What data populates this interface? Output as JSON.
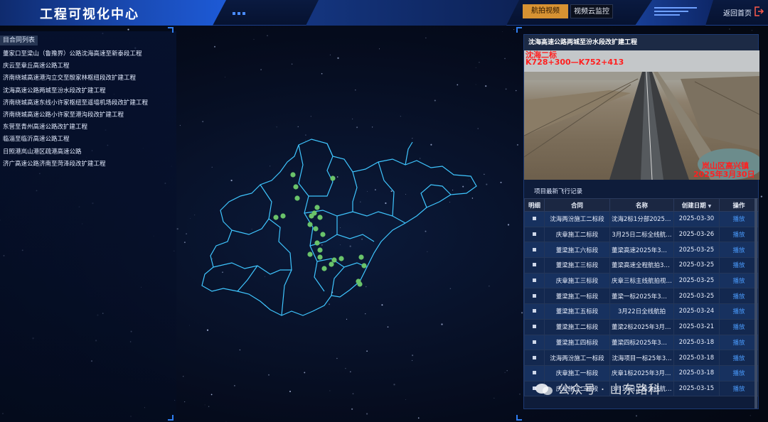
{
  "header": {
    "title": "工程可视化中心",
    "tabs": [
      {
        "label": "航拍视频",
        "active": true
      },
      {
        "label": "视频云监控",
        "active": false
      }
    ],
    "back_label": "返回首页",
    "accent_color": "#1d5ad6",
    "active_tab_color": "#d79232"
  },
  "left_panel": {
    "header": "目合同列表",
    "projects": [
      "董家口至梁山（鲁豫界）公路沈海高速至新泰段工程",
      "庆云至章丘高速公路工程",
      "济南绕城高速港沟立交至殷家林枢纽段改扩建工程",
      "沈海高速公路两城至汾水段改扩建工程",
      "济南绕城高速东线小许家枢纽至遥墙机场段改扩建工程",
      "济南绕城高速公路小许家至港沟段改扩建工程",
      "东营至青州高速公路改扩建工程",
      "临淄至临沂高速公路工程",
      "日照港岚山港区疏港高速公路",
      "济广高速公路济南至菏泽段改扩建工程"
    ]
  },
  "map": {
    "region_outline_color": "#3fc6ff",
    "marker_color": "#6ac36a"
  },
  "right_panel": {
    "title": "沈海高速公路两城至汾水段改扩建工程",
    "video": {
      "overlay_line1": "沈海二标",
      "overlay_line2": "K728+300—K752+413",
      "overlay_location": "岚山区高兴镇",
      "overlay_date": "2025年3月30日"
    },
    "section_label": "项目最新飞行记录",
    "table": {
      "columns": [
        "明细",
        "合同",
        "名称",
        "创建日期",
        "操作"
      ],
      "rows": [
        {
          "contract": "沈海两汾施工二标段",
          "name": "沈海2标1分部2025年…",
          "date": "2025-03-30",
          "action": "播放"
        },
        {
          "contract": "庆章施工二标段",
          "name": "3月25日二标全线航…",
          "date": "2025-03-26",
          "action": "播放"
        },
        {
          "contract": "董梁施工六标段",
          "name": "董梁高速2025年3月2…",
          "date": "2025-03-25",
          "action": "播放"
        },
        {
          "contract": "董梁施工三标段",
          "name": "董梁高速全程航拍3月…",
          "date": "2025-03-25",
          "action": "播放"
        },
        {
          "contract": "庆章施工三标段",
          "name": "庆章三标主线航拍视…",
          "date": "2025-03-25",
          "action": "播放"
        },
        {
          "contract": "董梁施工一标段",
          "name": "董梁一标2025年3月…",
          "date": "2025-03-25",
          "action": "播放"
        },
        {
          "contract": "董梁施工五标段",
          "name": "3月22日全线航拍",
          "date": "2025-03-24",
          "action": "播放"
        },
        {
          "contract": "董梁施工二标段",
          "name": "董梁2标2025年3月航…",
          "date": "2025-03-21",
          "action": "播放"
        },
        {
          "contract": "董梁施工四标段",
          "name": "董梁四标2025年3月…",
          "date": "2025-03-18",
          "action": "播放"
        },
        {
          "contract": "沈海两汾施工一标段",
          "name": "沈海项目一标25年3…",
          "date": "2025-03-18",
          "action": "播放"
        },
        {
          "contract": "庆章施工一标段",
          "name": "庆章1标2025年3月航…",
          "date": "2025-03-18",
          "action": "播放"
        },
        {
          "contract": "庆章施工二标段",
          "name": "3月15日二标全线航…",
          "date": "2025-03-15",
          "action": "播放"
        }
      ]
    }
  },
  "watermark": "公众号 · 山东路科"
}
